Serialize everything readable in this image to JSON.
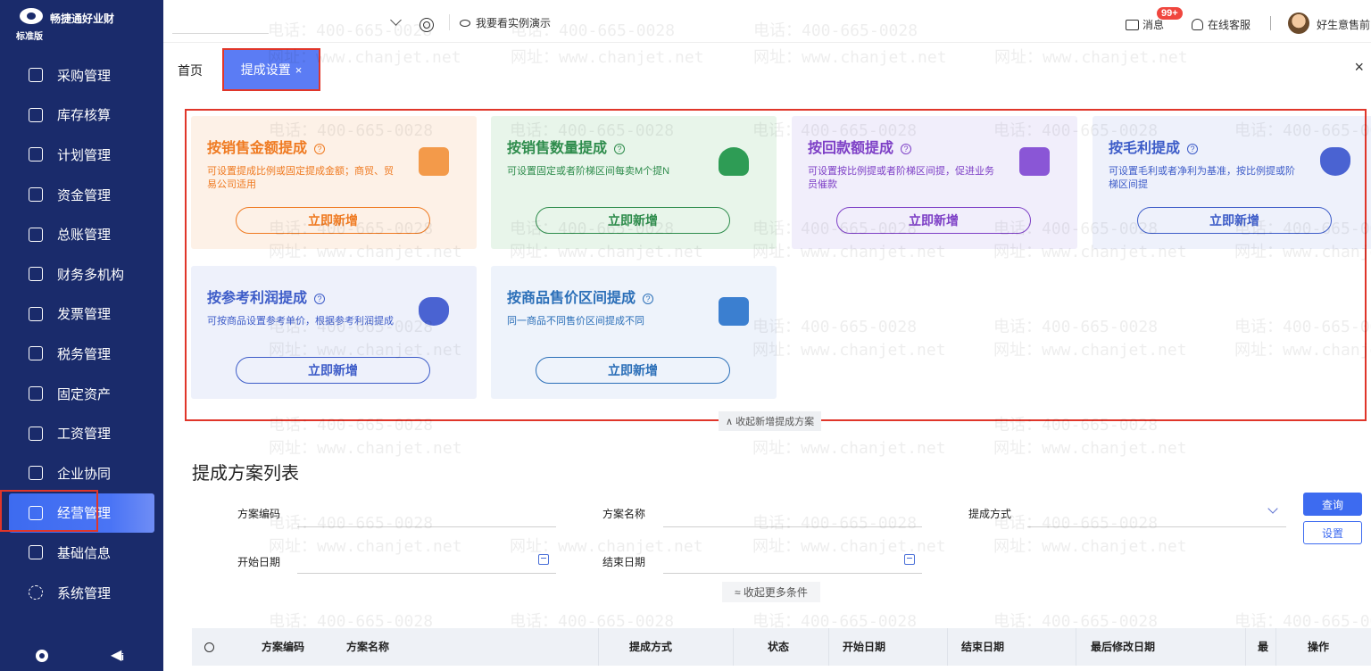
{
  "app": {
    "name": "畅捷通好业财",
    "edition": "标准版"
  },
  "sidebar": {
    "items": [
      {
        "label": "采购管理"
      },
      {
        "label": "库存核算"
      },
      {
        "label": "计划管理"
      },
      {
        "label": "资金管理"
      },
      {
        "label": "总账管理"
      },
      {
        "label": "财务多机构"
      },
      {
        "label": "发票管理"
      },
      {
        "label": "税务管理"
      },
      {
        "label": "固定资产"
      },
      {
        "label": "工资管理"
      },
      {
        "label": "企业协同"
      },
      {
        "label": "经营管理",
        "active": true
      },
      {
        "label": "基础信息"
      },
      {
        "label": "系统管理"
      }
    ]
  },
  "topbar": {
    "demo": "我要看实例演示",
    "messages": "消息",
    "messages_badge": "99+",
    "service": "在线客服",
    "user": "好生意售前"
  },
  "tabs": {
    "home": "首页",
    "active": "提成设置",
    "active_close": "×",
    "close_all": "×"
  },
  "watermark": {
    "phone": "电话：400-665-0028",
    "site": "网址：www.chanjet.net"
  },
  "cards": [
    {
      "title": "按销售金额提成",
      "desc": "可设置提成比例或固定提成金额；商贸、贸易公司适用",
      "button": "立即新增"
    },
    {
      "title": "按销售数量提成",
      "desc": "可设置固定或者阶梯区间每卖M个提N",
      "button": "立即新增"
    },
    {
      "title": "按回款额提成",
      "desc": "可设置按比例提或者阶梯区间提，促进业务员催款",
      "button": "立即新增"
    },
    {
      "title": "按毛利提成",
      "desc": "可设置毛利或者净利为基准，按比例提或阶梯区间提",
      "button": "立即新增"
    },
    {
      "title": "按参考利润提成",
      "desc": "可按商品设置参考单价，根据参考利润提成",
      "button": "立即新增"
    },
    {
      "title": "按商品售价区间提成",
      "desc": "同一商品不同售价区间提成不同",
      "button": "立即新增"
    }
  ],
  "collapse_new": "∧ 收起新增提成方案",
  "list": {
    "title": "提成方案列表",
    "filters": {
      "code": "方案编码",
      "name": "方案名称",
      "method": "提成方式",
      "start": "开始日期",
      "end": "结束日期"
    },
    "query": "查询",
    "settings": "设置",
    "collapse_more": "≈ 收起更多条件",
    "columns": [
      "方案编码",
      "方案名称",
      "提成方式",
      "状态",
      "开始日期",
      "结束日期",
      "最后修改日期",
      "最",
      "操作"
    ]
  },
  "colors": {
    "sidebar": "#1a2b6b",
    "accent": "#3d6bf0",
    "highlight": "#e0362a"
  }
}
